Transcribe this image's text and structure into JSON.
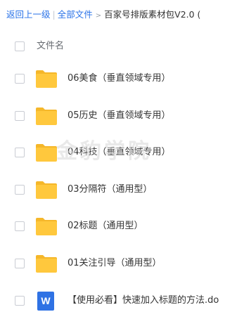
{
  "breadcrumb": {
    "back": "返回上一级",
    "sep": "|",
    "all_files": "全部文件",
    "arrow": ">",
    "current": "百家号排版素材包V2.0 ("
  },
  "header": {
    "label": "文件名"
  },
  "files": [
    {
      "name": "06美食（垂直领域专用）",
      "type": "folder"
    },
    {
      "name": "05历史（垂直领域专用）",
      "type": "folder"
    },
    {
      "name": "04科技（垂直领域专用）",
      "type": "folder"
    },
    {
      "name": "03分隔符（通用型）",
      "type": "folder"
    },
    {
      "name": "02标题（通用型）",
      "type": "folder"
    },
    {
      "name": "01关注引导（通用型）",
      "type": "folder"
    },
    {
      "name": "【使用必看】快速加入标题的方法.do",
      "type": "doc",
      "icon_letter": "W"
    }
  ],
  "watermark": "金豹学院",
  "colors": {
    "link": "#2a73e8",
    "folder": "#ffc83d",
    "word": "#2f72e4"
  }
}
